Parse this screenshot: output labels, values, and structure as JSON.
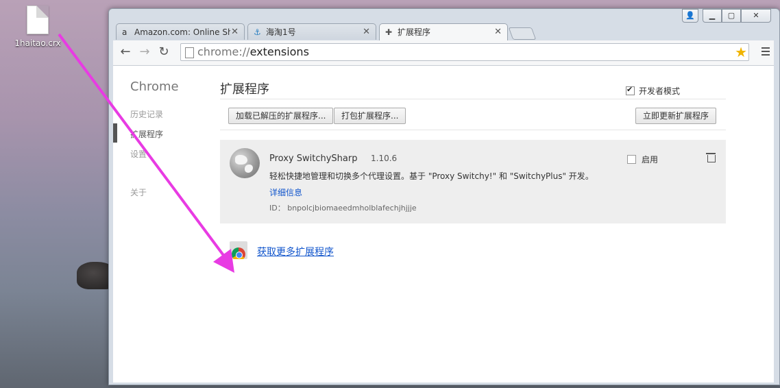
{
  "desktop": {
    "file_icon_label": "1haitao.crx"
  },
  "window": {
    "controls": {
      "user": "👤",
      "minimize": "▁",
      "maximize": "▢",
      "close": "✕"
    }
  },
  "tabs": [
    {
      "icon": "a",
      "title": "Amazon.com: Online Sh",
      "close": "✕"
    },
    {
      "icon": "⚓",
      "title": "海淘1号",
      "close": "✕"
    },
    {
      "icon": "✚",
      "title": "扩展程序",
      "close": "✕"
    }
  ],
  "toolbar": {
    "back": "←",
    "forward": "→",
    "reload": "↻",
    "url_scheme": "chrome://",
    "url_path": "extensions",
    "star": "★"
  },
  "sidebar": {
    "title": "Chrome",
    "items": [
      "历史记录",
      "扩展程序",
      "设置",
      "关于"
    ]
  },
  "main": {
    "title": "扩展程序",
    "developer_mode_label": "开发者模式",
    "developer_mode_checked": true,
    "load_unpacked_label": "加载已解压的扩展程序...",
    "pack_label": "打包扩展程序...",
    "update_now_label": "立即更新扩展程序"
  },
  "extension": {
    "name": "Proxy SwitchySharp",
    "version": "1.10.6",
    "description": "轻松快捷地管理和切换多个代理设置。基于 \"Proxy Switchy!\" 和 \"SwitchyPlus\" 开发。",
    "details_link": "详细信息",
    "id_label": "ID：",
    "id_value": "bnpolcjbiomaeedmholblafechjhjjje",
    "enable_label": "启用",
    "enabled": false
  },
  "store": {
    "link_text": "获取更多扩展程序"
  }
}
